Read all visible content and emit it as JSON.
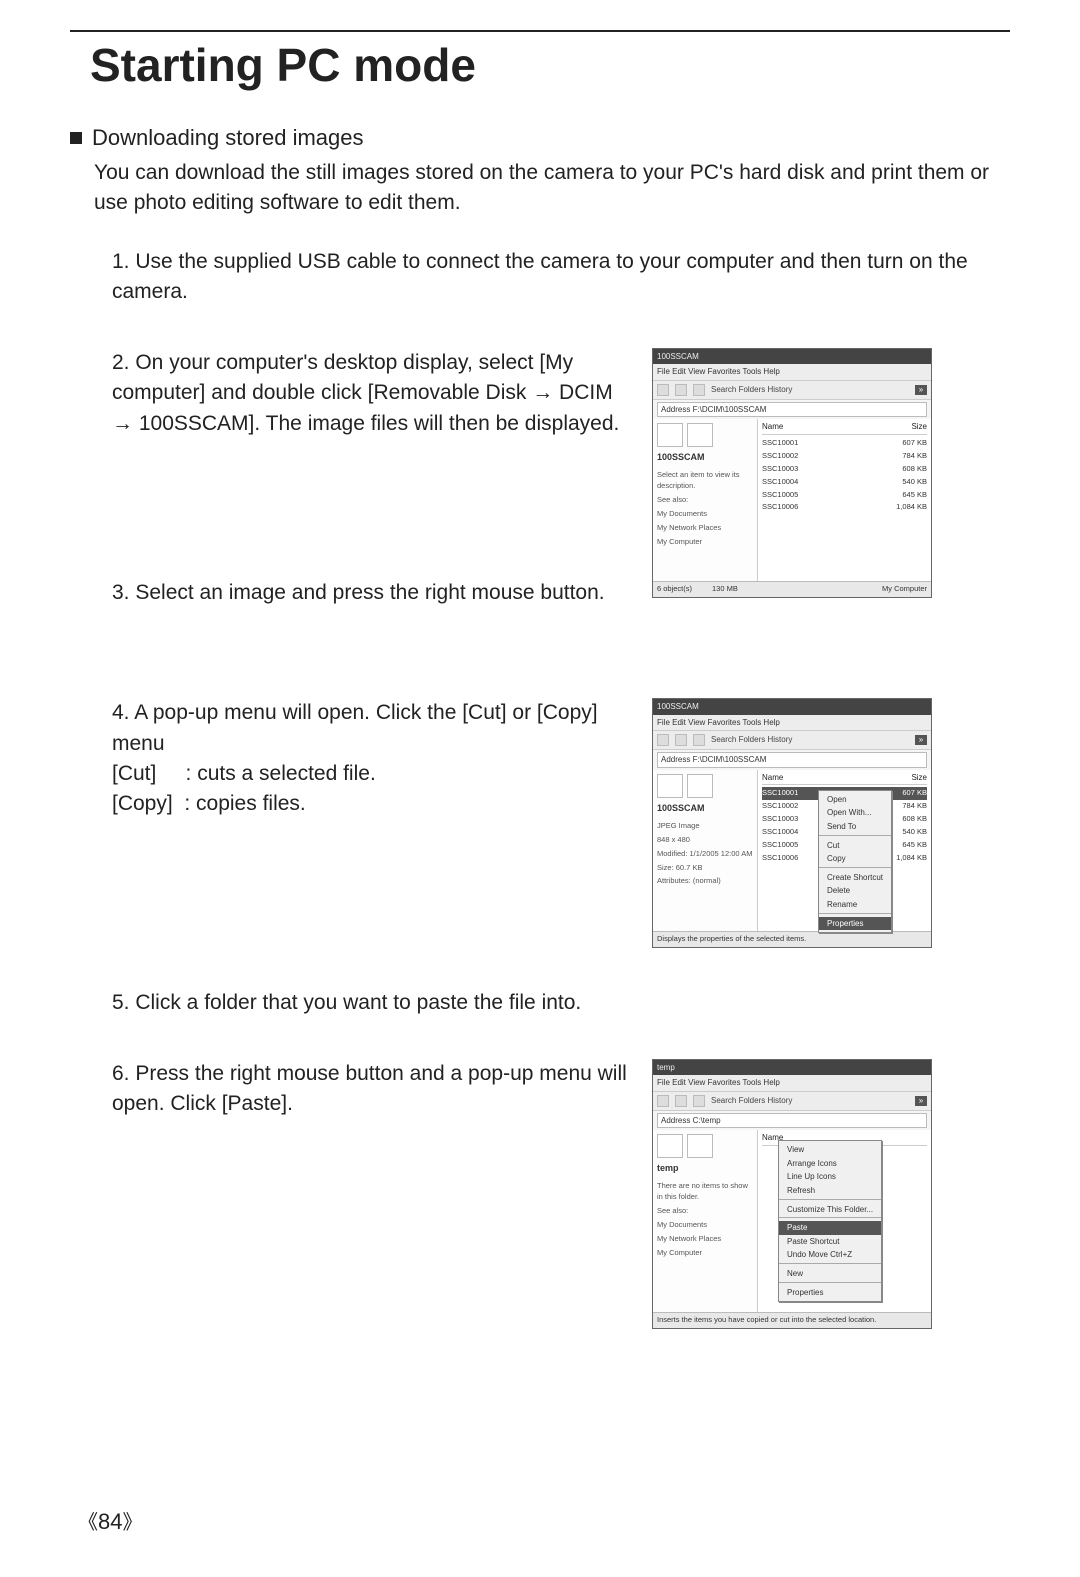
{
  "title": "Starting PC mode",
  "heading": "Downloading stored images",
  "intro": "You can download the still images stored on the camera to your PC's hard disk and print them or use photo editing software to edit them.",
  "steps": {
    "s1": "1. Use the supplied USB cable to connect the camera to your computer and then turn on the camera.",
    "s2": "2. On your computer's desktop display, select [My computer] and double click [Removable Disk → DCIM → 100SSCAM]. The image files will then be displayed.",
    "s3": "3. Select an image and press the right mouse button.",
    "s4_line1": "4. A pop-up menu will open. Click the [Cut] or [Copy] menu",
    "s4_line2": "[Cut]     : cuts a selected file.",
    "s4_line3": "[Copy]  : copies files.",
    "s5": "5. Click a folder that you want to paste the file into.",
    "s6": "6. Press the right mouse button and a pop-up menu will open. Click [Paste]."
  },
  "shot1": {
    "title": "100SSCAM",
    "menubar": "File   Edit   View   Favorites   Tools   Help",
    "address": "Address   F:\\DCIM\\100SSCAM",
    "foldername": "100SSCAM",
    "sidetext": "Select an item to view its description.",
    "links": [
      "See also:",
      "My Documents",
      "My Network Places",
      "My Computer"
    ],
    "col1": "Name",
    "col2": "Size",
    "rows": [
      [
        "SSC10001",
        "607 KB"
      ],
      [
        "SSC10002",
        "784 KB"
      ],
      [
        "SSC10003",
        "608 KB"
      ],
      [
        "SSC10004",
        "540 KB"
      ],
      [
        "SSC10005",
        "645 KB"
      ],
      [
        "SSC10006",
        "1,084 KB"
      ]
    ],
    "status_left": "6 object(s)",
    "status_mid": "130 MB",
    "status_right": "My Computer"
  },
  "shot2": {
    "title": "100SSCAM",
    "menubar": "File   Edit   View   Favorites   Tools   Help",
    "address": "Address   F:\\DCIM\\100SSCAM",
    "foldername": "100SSCAM",
    "sideinfo1": "JPEG Image",
    "sideinfo2": "848 x 480",
    "sidetext": "Modified: 1/1/2005 12:00 AM",
    "sidesize": "Size: 60.7 KB",
    "sideattr": "Attributes: (normal)",
    "col1": "Name",
    "col2": "Size",
    "rows": [
      [
        "SSC10001",
        "607 KB"
      ],
      [
        "SSC10002",
        "784 KB"
      ],
      [
        "SSC10003",
        "608 KB"
      ],
      [
        "SSC10004",
        "540 KB"
      ],
      [
        "SSC10005",
        "645 KB"
      ],
      [
        "SSC10006",
        "1,084 KB"
      ]
    ],
    "popup": [
      "Open",
      "Open With...",
      "Send To",
      "Cut",
      "Copy",
      "Create Shortcut",
      "Delete",
      "Rename",
      "Properties"
    ],
    "statusbar": "Displays the properties of the selected items."
  },
  "shot3": {
    "title": "temp",
    "menubar": "File   Edit   View   Favorites   Tools   Help",
    "address": "Address   C:\\temp",
    "foldername": "temp",
    "sidetext": "There are no items to show in this folder.",
    "links": [
      "See also:",
      "My Documents",
      "My Network Places",
      "My Computer"
    ],
    "col1": "Name",
    "popup_top": [
      "View",
      "Arrange Icons",
      "Line Up Icons",
      "Refresh"
    ],
    "popup_mid": [
      "Customize This Folder..."
    ],
    "popup_paste": "Paste",
    "popup_paste2": "Paste Shortcut",
    "popup_undo": "Undo Move      Ctrl+Z",
    "popup_bottom": [
      "New",
      "Properties"
    ],
    "statusbar": "Inserts the items you have copied or cut into the selected location."
  },
  "page_number": "84"
}
